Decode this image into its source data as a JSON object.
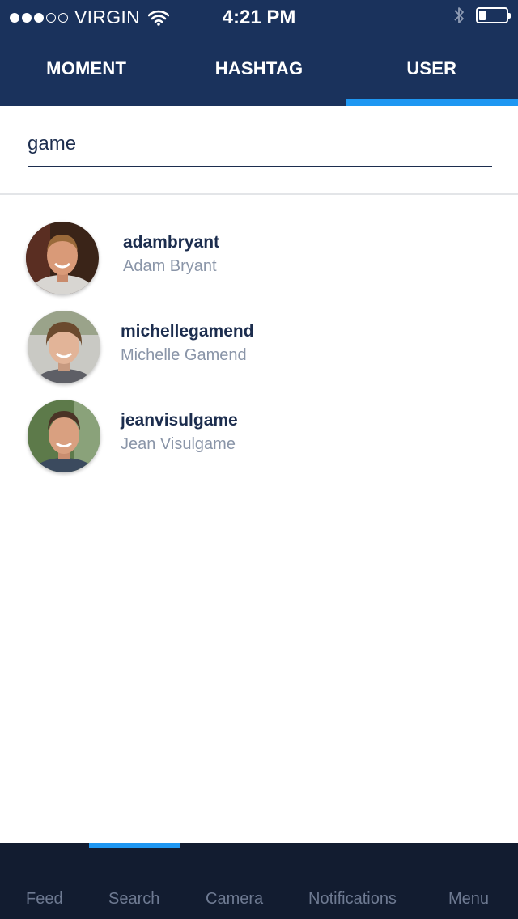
{
  "status_bar": {
    "carrier": "VIRGIN",
    "time": "4:21 PM",
    "signal_bars_filled": 3,
    "signal_bars_total": 5,
    "battery_level": 0.25
  },
  "tabs": [
    {
      "label": "MOMENT",
      "active": false
    },
    {
      "label": "HASHTAG",
      "active": false
    },
    {
      "label": "USER",
      "active": true
    }
  ],
  "search": {
    "value": "game"
  },
  "results": [
    {
      "username": "adambryant",
      "fullname": "Adam Bryant"
    },
    {
      "username": "michellegamend",
      "fullname": "Michelle Gamend"
    },
    {
      "username": "jeanvisulgame",
      "fullname": "Jean Visulgame"
    }
  ],
  "bottom_nav": [
    {
      "label": "Feed",
      "icon": "feed-icon"
    },
    {
      "label": "Search",
      "icon": "search-icon",
      "active": true
    },
    {
      "label": "Camera",
      "icon": "camera-icon"
    },
    {
      "label": "Notifications",
      "icon": "notifications-icon"
    },
    {
      "label": "Menu",
      "icon": "menu-icon"
    }
  ],
  "colors": {
    "header_bg": "#1a325c",
    "accent": "#1e97f2",
    "nav_bg": "#121c30",
    "username": "#1c2d4e",
    "fullname": "#8a95a8"
  }
}
